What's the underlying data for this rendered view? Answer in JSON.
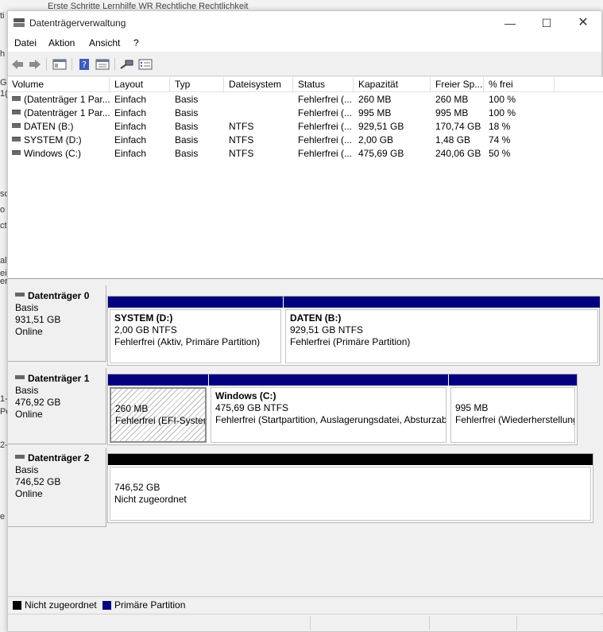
{
  "background": {
    "tab_text": "Erste Schritte   Lernhilfe WR   Rechtliche Rechtlichkeit",
    "left_glyphs": [
      "ti",
      "h",
      "G",
      "1(",
      "sc",
      "o",
      "ct",
      "al",
      "ei",
      "er",
      "1-",
      "Pc",
      "2-",
      "e"
    ]
  },
  "window": {
    "title": "Datenträgerverwaltung",
    "minimize_glyph": "—",
    "maximize_glyph": "☐",
    "close_glyph": "✕"
  },
  "menu": {
    "datei": "Datei",
    "aktion": "Aktion",
    "ansicht": "Ansicht",
    "help": "?"
  },
  "columns": {
    "volume": "Volume",
    "layout": "Layout",
    "typ": "Typ",
    "dateisystem": "Dateisystem",
    "status": "Status",
    "kapazitaet": "Kapazität",
    "frei": "Freier Sp...",
    "prozent": "% frei"
  },
  "volumes": [
    {
      "volume": "(Datenträger 1 Par...",
      "layout": "Einfach",
      "typ": "Basis",
      "dateisystem": "",
      "status": "Fehlerfrei (...",
      "kapazitaet": "260 MB",
      "frei": "260 MB",
      "prozent": "100 %"
    },
    {
      "volume": "(Datenträger 1 Par...",
      "layout": "Einfach",
      "typ": "Basis",
      "dateisystem": "",
      "status": "Fehlerfrei (...",
      "kapazitaet": "995 MB",
      "frei": "995 MB",
      "prozent": "100 %"
    },
    {
      "volume": "DATEN (B:)",
      "layout": "Einfach",
      "typ": "Basis",
      "dateisystem": "NTFS",
      "status": "Fehlerfrei (...",
      "kapazitaet": "929,51 GB",
      "frei": "170,74 GB",
      "prozent": "18 %"
    },
    {
      "volume": "SYSTEM (D:)",
      "layout": "Einfach",
      "typ": "Basis",
      "dateisystem": "NTFS",
      "status": "Fehlerfrei (...",
      "kapazitaet": "2,00 GB",
      "frei": "1,48 GB",
      "prozent": "74 %"
    },
    {
      "volume": "Windows (C:)",
      "layout": "Einfach",
      "typ": "Basis",
      "dateisystem": "NTFS",
      "status": "Fehlerfrei (...",
      "kapazitaet": "475,69 GB",
      "frei": "240,06 GB",
      "prozent": "50 %"
    }
  ],
  "disks": [
    {
      "name": "Datenträger 0",
      "type": "Basis",
      "size": "931,51 GB",
      "state": "Online",
      "partitions": [
        {
          "title": "SYSTEM  (D:)",
          "size": "2,00 GB NTFS",
          "status": "Fehlerfrei (Aktiv, Primäre Partition)"
        },
        {
          "title": "DATEN  (B:)",
          "size": "929,51 GB NTFS",
          "status": "Fehlerfrei (Primäre Partition)"
        }
      ]
    },
    {
      "name": "Datenträger 1",
      "type": "Basis",
      "size": "476,92 GB",
      "state": "Online",
      "partitions": [
        {
          "title": "",
          "size": "260 MB",
          "status": "Fehlerfrei (EFI-Systempartition)"
        },
        {
          "title": "Windows  (C:)",
          "size": "475,69 GB NTFS",
          "status": "Fehlerfrei (Startpartition, Auslagerungsdatei, Absturzabbild, Primäre Partition)"
        },
        {
          "title": "",
          "size": "995 MB",
          "status": "Fehlerfrei (Wiederherstellungspartition)"
        }
      ]
    },
    {
      "name": "Datenträger 2",
      "type": "Basis",
      "size": "746,52 GB",
      "state": "Online",
      "partitions": [
        {
          "title": "",
          "size": "746,52 GB",
          "status": "Nicht zugeordnet"
        }
      ]
    }
  ],
  "legend": {
    "unallocated": "Nicht zugeordnet",
    "unallocated_color": "#000000",
    "primary": "Primäre Partition",
    "primary_color": "#000080"
  }
}
